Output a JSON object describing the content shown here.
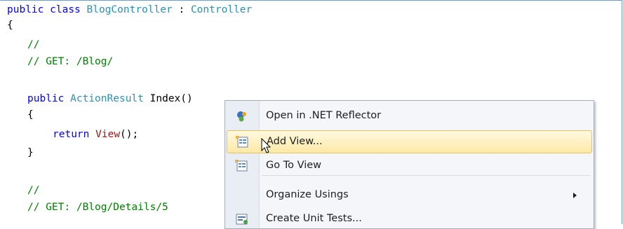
{
  "code": {
    "line1": {
      "kw1": "public",
      "kw2": "class",
      "name": "BlogController",
      "sep": " : ",
      "base": "Controller"
    },
    "line2": "{",
    "line3": "//",
    "line4": "// GET: /Blog/",
    "line6": {
      "kw": "public",
      "type": "ActionResult",
      "name": "Index()"
    },
    "line7": "{",
    "line8": {
      "kw": "return",
      "call": "View",
      "rest": "();"
    },
    "line9": "}",
    "line11": "//",
    "line12": "// GET: /Blog/Details/5"
  },
  "context_menu": {
    "items": [
      {
        "label": "Open in .NET Reflector",
        "icon": "reflector-icon"
      },
      {
        "label": "Add View...",
        "icon": "add-view-icon",
        "highlighted": true
      },
      {
        "label": "Go To View",
        "icon": "go-to-view-icon"
      },
      {
        "label": "Organize Usings",
        "has_submenu": true
      },
      {
        "label": "Create Unit Tests...",
        "icon": "unit-tests-icon"
      }
    ]
  },
  "colors": {
    "keyword": "#0000ff",
    "comment": "#008000",
    "type": "#2b91af",
    "method_call": "#a31515",
    "menu_highlight": "#fde9a6"
  }
}
